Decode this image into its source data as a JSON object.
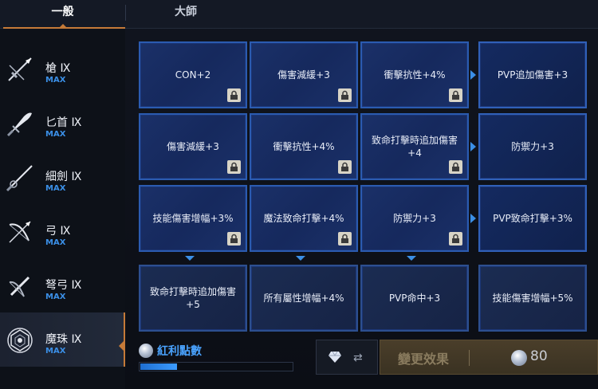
{
  "tabs": [
    {
      "label": "一般",
      "active": true
    },
    {
      "label": "大師",
      "active": false
    }
  ],
  "weapons": [
    {
      "name": "槍 Ⅸ",
      "level": "MAX",
      "icon": "spear-icon",
      "active": false
    },
    {
      "name": "匕首 Ⅸ",
      "level": "MAX",
      "icon": "dagger-icon",
      "active": false
    },
    {
      "name": "細劍 Ⅸ",
      "level": "MAX",
      "icon": "rapier-icon",
      "active": false
    },
    {
      "name": "弓 Ⅸ",
      "level": "MAX",
      "icon": "bow-icon",
      "active": false
    },
    {
      "name": "弩弓 Ⅸ",
      "level": "MAX",
      "icon": "crossbow-icon",
      "active": false
    },
    {
      "name": "魔珠 Ⅸ",
      "level": "MAX",
      "icon": "orb-icon",
      "active": true
    }
  ],
  "grid": {
    "rows": [
      [
        {
          "text": "CON+2",
          "locked": true
        },
        {
          "text": "傷害減緩+3",
          "locked": true
        },
        {
          "text": "衝擊抗性+4%",
          "locked": true
        },
        {
          "text": "PVP追加傷害+3",
          "locked": false
        }
      ],
      [
        {
          "text": "傷害減緩+3",
          "locked": true
        },
        {
          "text": "衝擊抗性+4%",
          "locked": true
        },
        {
          "text": "致命打擊時追加傷害+4",
          "locked": true
        },
        {
          "text": "防禦力+3",
          "locked": false
        }
      ],
      [
        {
          "text": "技能傷害增幅+3%",
          "locked": true
        },
        {
          "text": "魔法致命打擊+4%",
          "locked": true
        },
        {
          "text": "防禦力+3",
          "locked": true
        },
        {
          "text": "PVP致命打擊+3%",
          "locked": false
        }
      ],
      [
        {
          "text": "致命打擊時追加傷害+5",
          "locked": false
        },
        {
          "text": "所有屬性增幅+4%",
          "locked": false
        },
        {
          "text": "PVP命中+3",
          "locked": false
        },
        {
          "text": "技能傷害增幅+5%",
          "locked": false
        }
      ]
    ]
  },
  "bonus": {
    "label": "紅利點數",
    "progress": 0.24
  },
  "change_button": {
    "label": "變更效果",
    "cost": "80"
  },
  "colors": {
    "accent_orange": "#c57a38",
    "accent_blue": "#3b8fe6",
    "cell_border": "#2b5bb0"
  }
}
